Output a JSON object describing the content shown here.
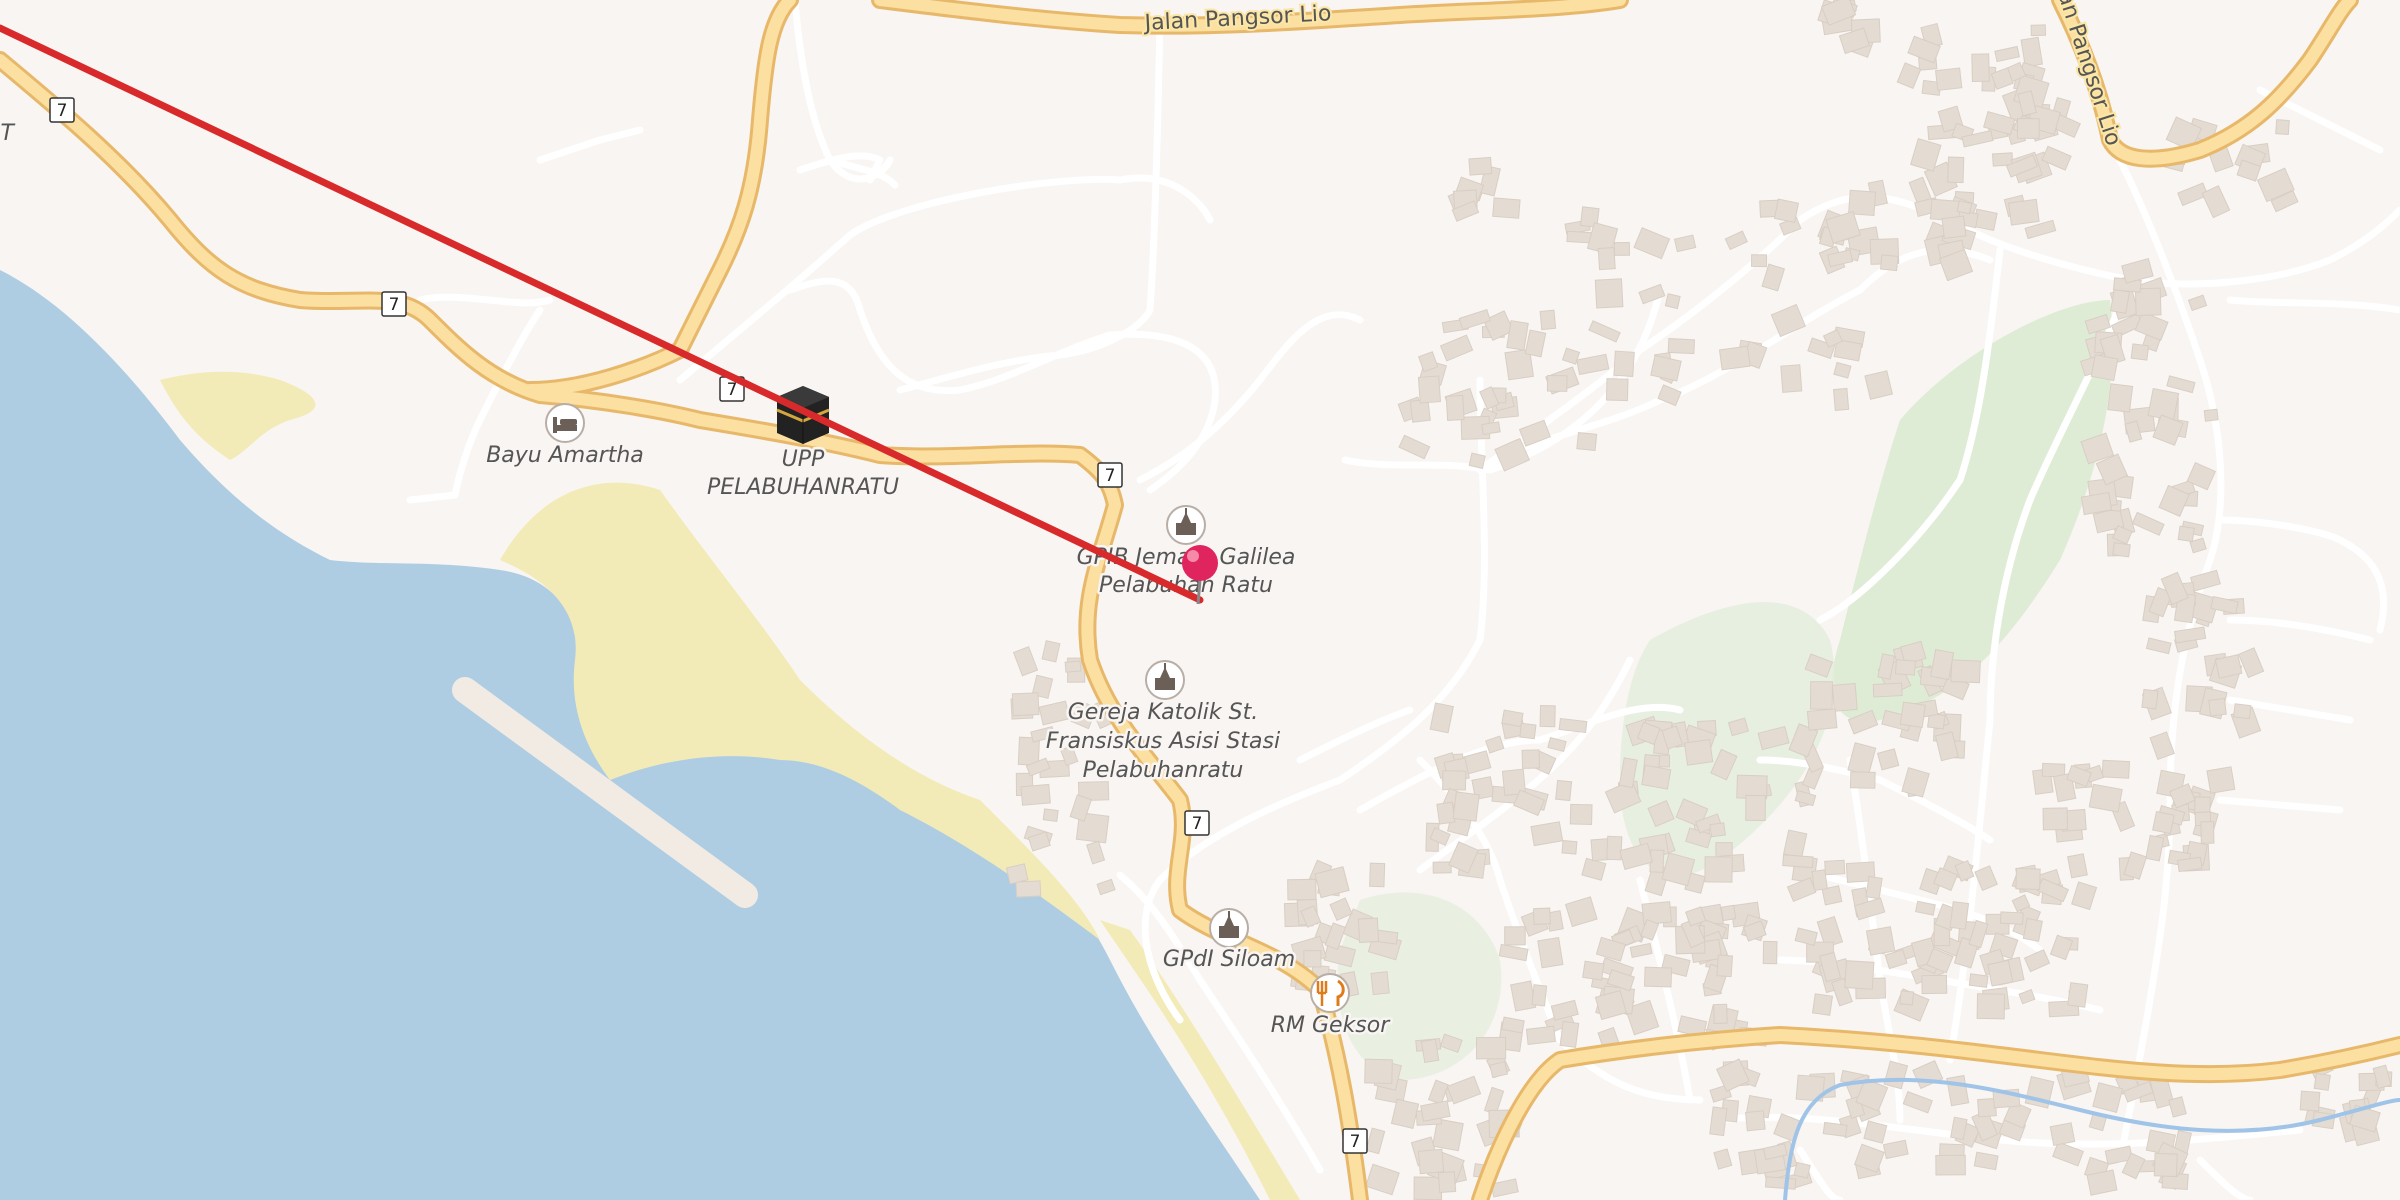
{
  "map": {
    "road_names": [
      {
        "id": "road-jalan-pangsor-lio-north",
        "text": "Jalan Pangsor Lio"
      },
      {
        "id": "road-jalan-pangsor-lio-east",
        "text": "an Pangsor Lio"
      }
    ],
    "route_shield": "7",
    "edge_fragment": "IT",
    "pois": [
      {
        "id": "poi-bayu-amartha",
        "icon": "hotel-bed-icon",
        "lines": [
          "Bayu Amartha"
        ]
      },
      {
        "id": "poi-upp-pelabuhanratu",
        "icon": "kaaba-icon",
        "lines": [
          "UPP",
          "PELABUHANRATU"
        ]
      },
      {
        "id": "poi-gpib-jemaat-galilea",
        "icon": "church-icon",
        "lines": [
          "GPIB Jemaat Galilea",
          "Pelabuhan Ratu"
        ]
      },
      {
        "id": "poi-gereja-katolik",
        "icon": "church-icon",
        "lines": [
          "Gereja Katolik St.",
          "Fransiskus Asisi Stasi",
          "Pelabuhanratu"
        ]
      },
      {
        "id": "poi-gpdi-siloam",
        "icon": "church-icon",
        "lines": [
          "GPdI Siloam"
        ]
      },
      {
        "id": "poi-rm-geksor",
        "icon": "restaurant-fork-knife-icon",
        "lines": [
          "RM Geksor"
        ]
      }
    ],
    "marker": {
      "icon": "pin-marker-icon",
      "color": "#e0245e"
    },
    "route_line_color": "#d82a2a",
    "colors": {
      "land": "#f8f5f2",
      "water": "#aecde3",
      "sand": "#f3ebb7",
      "park": "#dcebd1",
      "major_road": "#fbe0a1",
      "major_road_casing": "#e8b86a",
      "minor_road": "#ffffff",
      "building": "#e4dbd2"
    }
  }
}
